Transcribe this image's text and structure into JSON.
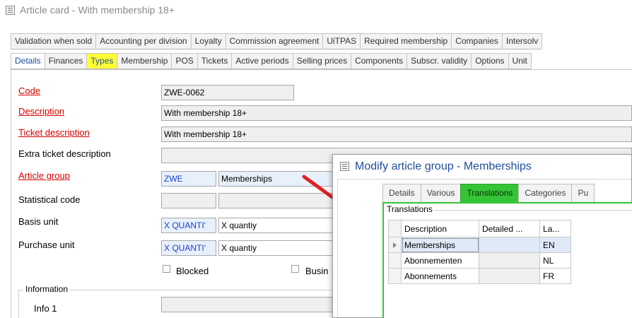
{
  "window": {
    "title": "Article card - With membership 18+"
  },
  "tabs_row1": [
    "Validation when sold",
    "Accounting per division",
    "Loyalty",
    "Commission agreement",
    "UiTPAS",
    "Required membership",
    "Companies",
    "Intersolv"
  ],
  "tabs_row2": [
    "Details",
    "Finances",
    "Types",
    "Membership",
    "POS",
    "Tickets",
    "Active periods",
    "Selling prices",
    "Components",
    "Subscr. validity",
    "Options",
    "Unit"
  ],
  "form": {
    "code_label": "Code",
    "code_value": "ZWE-0062",
    "description_label": "Description",
    "description_value": "With membership 18+",
    "ticket_description_label": "Ticket description",
    "ticket_description_value": "With membership 18+",
    "extra_ticket_description_label": "Extra ticket description",
    "article_group_label": "Article group",
    "article_group_code": "ZWE",
    "article_group_name": "Memberships",
    "statistical_code_label": "Statistical code",
    "basis_unit_label": "Basis unit",
    "basis_unit_code": "X QUANTI'",
    "basis_unit_name": "X quantiy",
    "purchase_unit_label": "Purchase unit",
    "purchase_unit_code": "X QUANTI'",
    "purchase_unit_name": "X quantiy",
    "blocked_label": "Blocked",
    "business_label": "Busin",
    "information_group": "Information",
    "info1_label": "Info 1"
  },
  "dialog": {
    "title": "Modify article group - Memberships",
    "tabs": [
      "Details",
      "Various",
      "Translations",
      "Categories",
      "Pu"
    ],
    "active_tab": "Translations",
    "translations_group": "Translations",
    "columns": [
      "Description",
      "Detailed ...",
      "La..."
    ],
    "rows": [
      {
        "description": "Memberships",
        "detailed": "",
        "language": "EN"
      },
      {
        "description": "Abonnementen",
        "detailed": "",
        "language": "NL"
      },
      {
        "description": "Abonnements",
        "detailed": "",
        "language": "FR"
      }
    ]
  },
  "colors": {
    "required_label": "#d40000",
    "highlight_tab": "#ffff33",
    "active_dialog_tab": "#35c435",
    "arrow": "#e02020"
  }
}
